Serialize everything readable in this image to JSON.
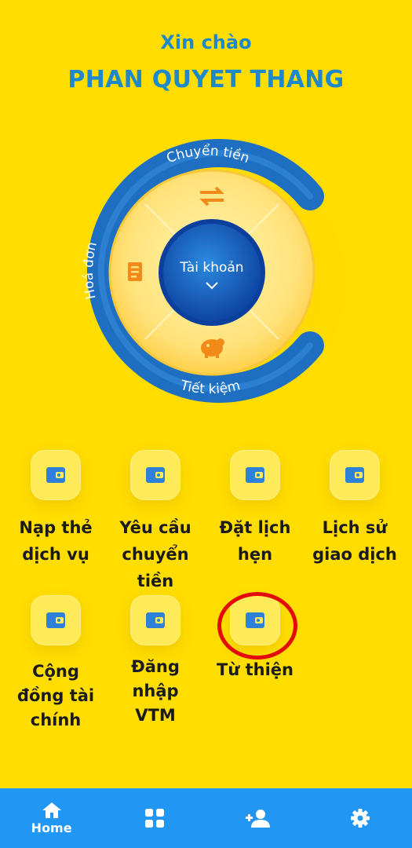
{
  "header": {
    "greeting": "Xin chào",
    "user_name": "PHAN QUYET THANG"
  },
  "wheel": {
    "center_label": "Tài khoản",
    "top_label": "Chuyển tiền",
    "left_label": "Hoá đơn",
    "bottom_label": "Tiết kiệm"
  },
  "services": {
    "row1": [
      {
        "line1": "Nạp thẻ",
        "line2": "dịch vụ",
        "line3": ""
      },
      {
        "line1": "Yêu cầu",
        "line2": "chuyển",
        "line3": "tiền"
      },
      {
        "line1": "Đặt lịch",
        "line2": "hẹn",
        "line3": ""
      },
      {
        "line1": "Lịch sử",
        "line2": "giao dịch",
        "line3": ""
      }
    ],
    "row2": [
      {
        "line1": "Cộng",
        "line2": "đồng tài",
        "line3": "chính"
      },
      {
        "line1": "Đăng",
        "line2": "nhập",
        "line3": "VTM"
      },
      {
        "line1": "Từ thiện",
        "line2": "",
        "line3": ""
      }
    ]
  },
  "bottom_nav": {
    "home_label": "Home",
    "items": [
      "home-icon",
      "grid-icon",
      "add-person-icon",
      "gear-icon"
    ]
  },
  "colors": {
    "background": "#FFDD00",
    "accent_blue": "#1E88C8",
    "nav_blue": "#2196F3",
    "highlight_red": "#E30A0A"
  }
}
